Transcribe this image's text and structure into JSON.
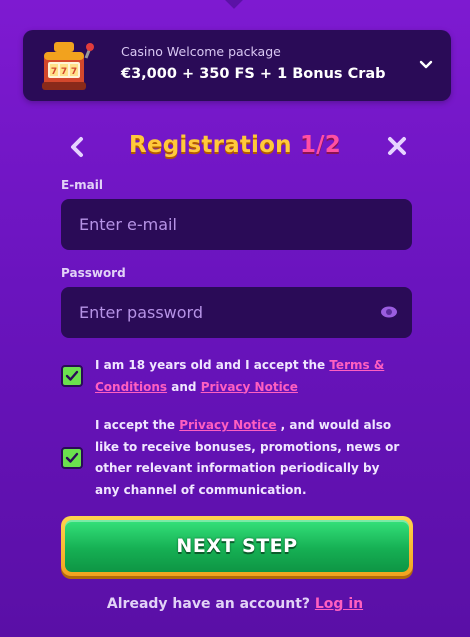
{
  "promo": {
    "title": "Casino Welcome package",
    "value": "€3,000 + 350 FS + 1 Bonus Crab",
    "icon": "slot-machine-icon"
  },
  "header": {
    "title": "Registration",
    "step": "1/2"
  },
  "form": {
    "email_label": "E-mail",
    "email_placeholder": "Enter e-mail",
    "email_value": "",
    "password_label": "Password",
    "password_placeholder": "Enter password",
    "password_value": ""
  },
  "consents": {
    "age": {
      "checked": true,
      "prefix": "I am 18 years old and I accept the",
      "terms_link": "Terms & Conditions",
      "middle": "and",
      "privacy_link": "Privacy Notice"
    },
    "marketing": {
      "checked": true,
      "prefix": "I accept the",
      "privacy_link": "Privacy Notice",
      "suffix": ", and would also like to receive bonuses, promotions, news or other relevant information periodically by any channel of communication."
    }
  },
  "actions": {
    "next_label": "NEXT STEP"
  },
  "footer": {
    "text": "Already have an account?",
    "login_link": "Log in"
  },
  "colors": {
    "background": "#6a14be",
    "panel": "#2a0b57",
    "title_yellow": "#ffc93b",
    "title_pink": "#ff4fa3",
    "link_pink": "#ff5fc0",
    "check_green": "#6be04e",
    "button_green": "#16b054",
    "button_border": "#f2a21e"
  }
}
